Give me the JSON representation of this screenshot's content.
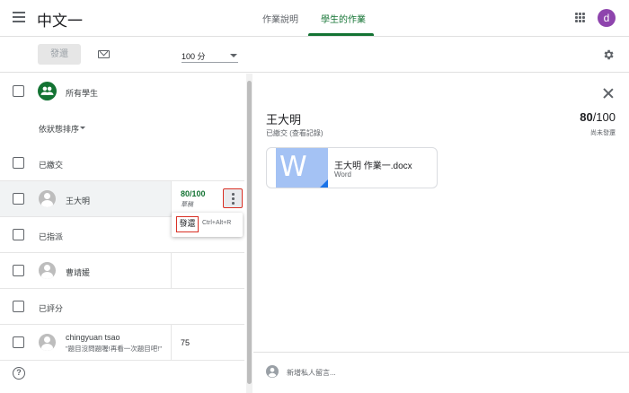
{
  "header": {
    "class_title": "中文一",
    "tabs": [
      {
        "label": "作業說明"
      },
      {
        "label": "學生的作業"
      }
    ],
    "account_initial": "d"
  },
  "toolbar": {
    "return_label": "發還",
    "points_value": "100 分"
  },
  "list": {
    "all_students_label": "所有學生",
    "sort_label": "依狀態排序",
    "sections": {
      "turned_in": "已繳交",
      "assigned": "已指派",
      "graded": "已評分"
    },
    "students": [
      {
        "name": "王大明",
        "grade": "80/100",
        "grade_sub": "草稿"
      },
      {
        "name": "曹靖媛",
        "grade": "",
        "grade_sub": ""
      },
      {
        "name": "chingyuan tsao",
        "comment": "\"題目沒問題喔!再看一次題目吧!\"",
        "grade": "75"
      }
    ]
  },
  "context_menu": {
    "return_label": "發還",
    "shortcut": "Ctrl+Alt+R"
  },
  "detail": {
    "student_name": "王大明",
    "status": "已繳交 (查看記錄)",
    "score": "80",
    "score_total": "/100",
    "score_note": "尚未發還",
    "file": {
      "name": "王大明 作業一.docx",
      "type": "Word",
      "thumb_letter": "W"
    },
    "comment_placeholder": "新增私人留言..."
  },
  "colors": {
    "accent_green": "#137333",
    "avatar_purple": "#8e44ad",
    "highlight_red": "#d93025",
    "word_blue": "#a4c2f4"
  }
}
